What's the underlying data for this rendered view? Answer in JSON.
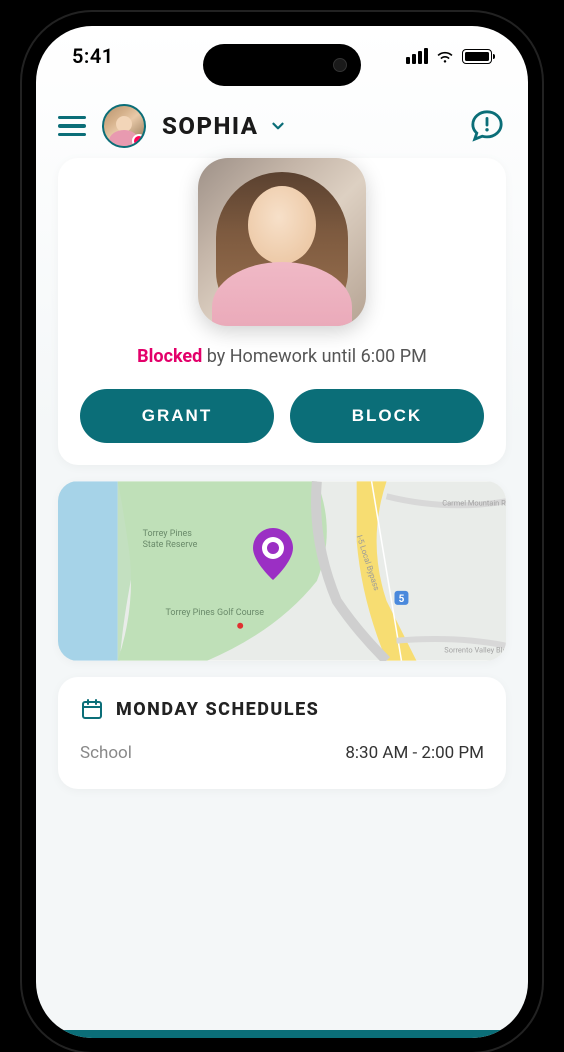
{
  "status_bar": {
    "time": "5:41"
  },
  "header": {
    "profile_name": "SOPHIA"
  },
  "main_card": {
    "status_word": "Blocked",
    "status_rest": " by Homework until 6:00 PM",
    "grant_label": "GRANT",
    "block_label": "BLOCK"
  },
  "map": {
    "labels": {
      "reserve": "Torrey Pines\nState Reserve",
      "golf": "Torrey Pines Golf Course",
      "hwy": "I-5 Local Bypass",
      "rd1": "Carmel Mountain Rd",
      "rd2": "Sorrento Valley Blvd"
    }
  },
  "schedules": {
    "title": "MONDAY SCHEDULES",
    "items": [
      {
        "label": "School",
        "time": "8:30 AM - 2:00 PM"
      }
    ]
  },
  "colors": {
    "accent": "#0b6e78",
    "danger": "#e3006a"
  }
}
